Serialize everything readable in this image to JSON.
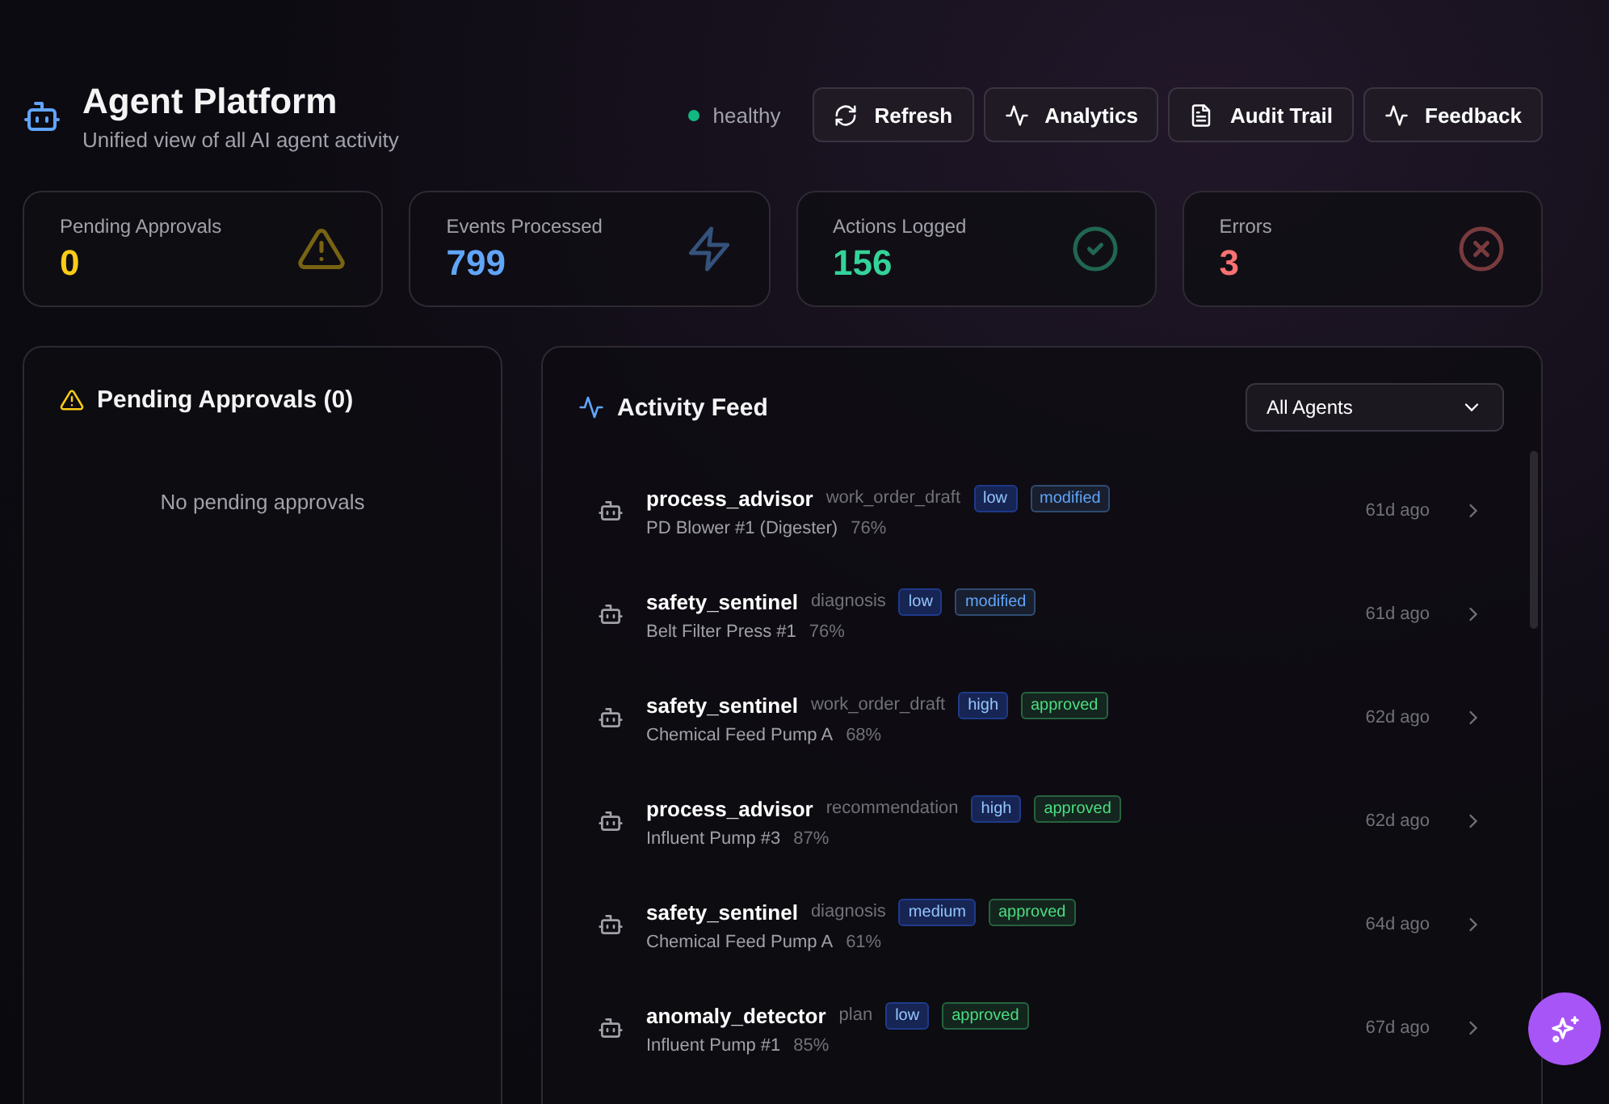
{
  "header": {
    "title": "Agent Platform",
    "subtitle": "Unified view of all AI agent activity",
    "health": "healthy",
    "buttons": [
      {
        "kind": "refresh",
        "label": "Refresh"
      },
      {
        "kind": "pulse",
        "label": "Analytics"
      },
      {
        "kind": "document",
        "label": "Audit Trail"
      },
      {
        "kind": "pulse",
        "label": "Feedback"
      }
    ]
  },
  "stats": [
    {
      "kind": "warning",
      "label": "Pending Approvals",
      "value": "0",
      "color": "#facc15"
    },
    {
      "kind": "bolt",
      "label": "Events Processed",
      "value": "799",
      "color": "#60a5fa"
    },
    {
      "kind": "check",
      "label": "Actions Logged",
      "value": "156",
      "color": "#34d399"
    },
    {
      "kind": "error",
      "label": "Errors",
      "value": "3",
      "color": "#f87171"
    }
  ],
  "pending_panel": {
    "title": "Pending Approvals (0)",
    "empty_text": "No pending approvals"
  },
  "activity_feed": {
    "title": "Activity Feed",
    "filter": "All Agents",
    "items": [
      {
        "agent": "process_advisor",
        "type": "work_order_draft",
        "priority": "low",
        "status": "modified",
        "color": "#60a5fa",
        "asset": "PD Blower #1 (Digester)",
        "confidence": "76%",
        "time": "61d ago"
      },
      {
        "agent": "safety_sentinel",
        "type": "diagnosis",
        "priority": "low",
        "status": "modified",
        "color": "#60a5fa",
        "asset": "Belt Filter Press #1",
        "confidence": "76%",
        "time": "61d ago"
      },
      {
        "agent": "safety_sentinel",
        "type": "work_order_draft",
        "priority": "high",
        "status": "approved",
        "color": "#4ade80",
        "asset": "Chemical Feed Pump A",
        "confidence": "68%",
        "time": "62d ago"
      },
      {
        "agent": "process_advisor",
        "type": "recommendation",
        "priority": "high",
        "status": "approved",
        "color": "#4ade80",
        "asset": "Influent Pump #3",
        "confidence": "87%",
        "time": "62d ago"
      },
      {
        "agent": "safety_sentinel",
        "type": "diagnosis",
        "priority": "medium",
        "status": "approved",
        "color": "#4ade80",
        "asset": "Chemical Feed Pump A",
        "confidence": "61%",
        "time": "64d ago"
      },
      {
        "agent": "anomaly_detector",
        "type": "plan",
        "priority": "low",
        "status": "approved",
        "color": "#4ade80",
        "asset": "Influent Pump #1",
        "confidence": "85%",
        "time": "67d ago"
      }
    ]
  }
}
